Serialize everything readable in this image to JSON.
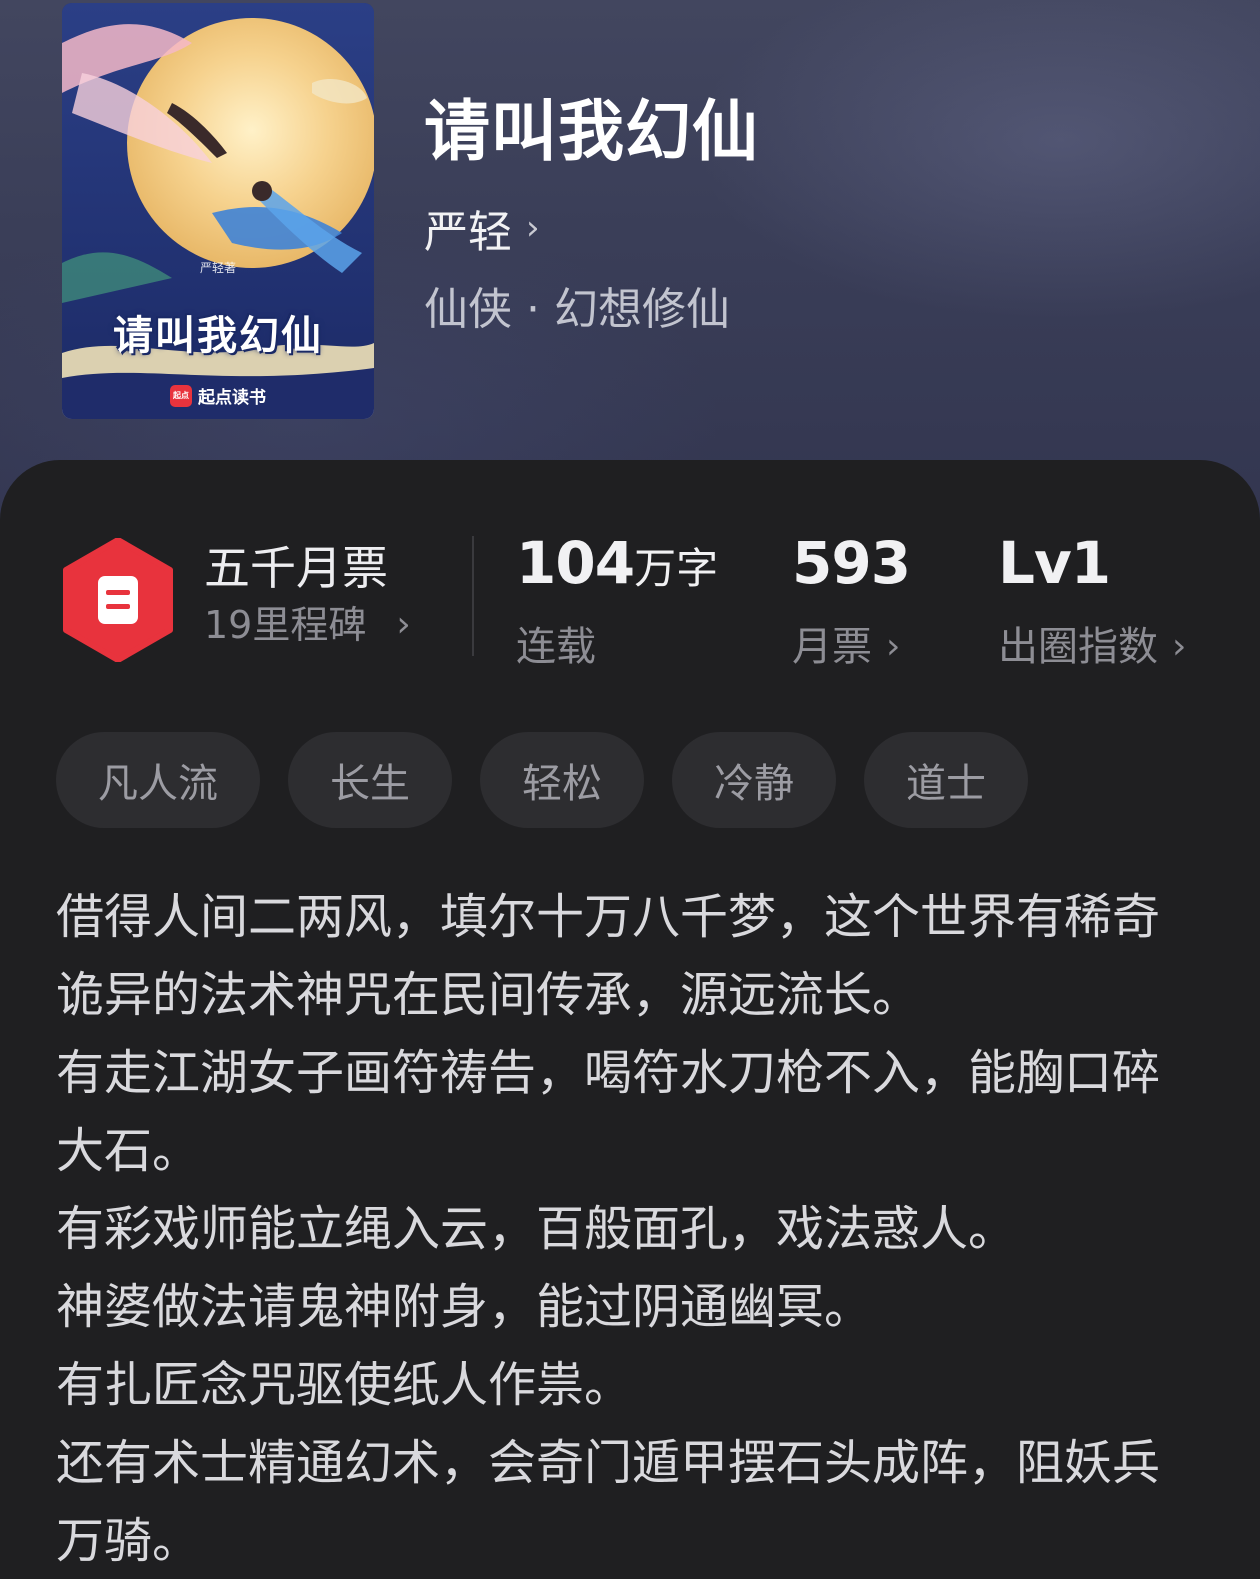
{
  "cover": {
    "title": "请叫我幻仙",
    "author_credit": "严轻著",
    "publisher": "起点读书",
    "publisher_logo_text": "起点"
  },
  "book": {
    "title": "请叫我幻仙",
    "author": "严轻",
    "genre": "仙侠 · 幻想修仙"
  },
  "stats": {
    "badge": {
      "title": "五千月票",
      "subtitle": "19里程碑"
    },
    "word_count": {
      "number": "104",
      "unit": "万字",
      "label": "连载"
    },
    "monthly_tickets": {
      "number": "593",
      "label": "月票"
    },
    "popularity": {
      "number": "Lv1",
      "label": "出圈指数"
    }
  },
  "tags": [
    "凡人流",
    "长生",
    "轻松",
    "冷静",
    "道士"
  ],
  "synopsis": [
    "借得人间二两风，填尔十万八千梦，这个世界有稀奇诡异的法术神咒在民间传承，源远流长。",
    "有走江湖女子画符祷告，喝符水刀枪不入，能胸口碎大石。",
    "有彩戏师能立绳入云，百般面孔，戏法惑人。",
    "神婆做法请鬼神附身，能过阴通幽冥。",
    "有扎匠念咒驱使纸人作祟。",
    "还有术士精通幻术，会奇门遁甲摆石头成阵，阻妖兵万骑。"
  ],
  "colors": {
    "badge_red": "#e8333d",
    "card_bg": "#1f1f21",
    "tag_bg": "#2d2d30"
  },
  "icons": {
    "author_chevron": "chevron-right-icon",
    "badge": "ticket-hexagon-icon"
  }
}
